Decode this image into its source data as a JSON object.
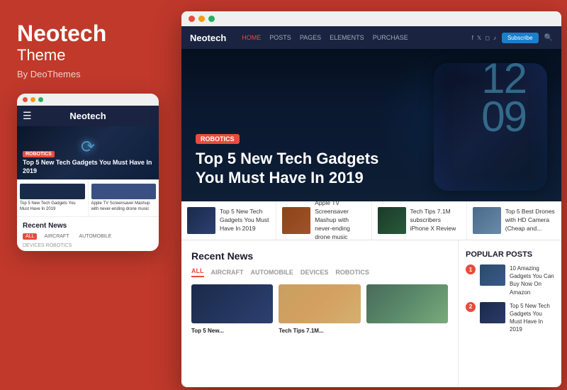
{
  "left": {
    "title": "Neotech",
    "subtitle": "Theme",
    "by": "By DeoThemes"
  },
  "mobile": {
    "nav_title": "Neotech",
    "hero_badge": "ROBOTICS",
    "hero_title": "Top 5 New Tech Gadgets You Must Have In 2019",
    "thumb1_text": "Top 5 New Tech Gadgets You Must Have In 2019",
    "thumb2_text": "Apple TV Screensaver Mashup with never-ending drone music",
    "recent_title": "Recent News",
    "tab_all": "ALL",
    "tab_aircraft": "AIRCRAFT",
    "tab_automobile": "AUTOMOBILE",
    "recent_sub": "DEVICES   ROBOTICS"
  },
  "browser": {
    "logo": "Neotech",
    "nav_links": [
      "HOME",
      "POSTS",
      "PAGES",
      "ELEMENTS",
      "PURCHASE"
    ],
    "active_nav": "HOME",
    "subscribe_label": "Subscribe",
    "hero_badge": "ROBOTICS",
    "hero_title": "Top 5 New Tech Gadgets You Must Have In 2019",
    "hero_numbers": "12\n09",
    "thumbs": [
      {
        "text": "Top 5 New Tech Gadgets You Must Have In 2019"
      },
      {
        "text": "Apple TV Screensaver Mashup with never-ending drone music"
      },
      {
        "text": "Tech Tips 7.1M subscribers iPhone X Review"
      },
      {
        "text": "Top 5 Best Drones with HD Camera (Cheap and..."
      }
    ],
    "recent_news_title": "Recent News",
    "filter_tabs": [
      "ALL",
      "AIRCRAFT",
      "AUTOMOBILE",
      "DEVICES",
      "ROBOTICS"
    ],
    "active_filter": "ALL",
    "news_cards": [
      {
        "title": "Top 5 New..."
      },
      {
        "title": "Tech Tips 7.1M..."
      }
    ],
    "popular_title": "POPULAR POSTS",
    "popular": [
      {
        "num": "1",
        "text": "10 Amazing Gadgets You Can Buy Now On Amazon"
      },
      {
        "num": "2",
        "text": "Top 5 New Tech Gadgets You Must Have In 2019"
      }
    ]
  }
}
